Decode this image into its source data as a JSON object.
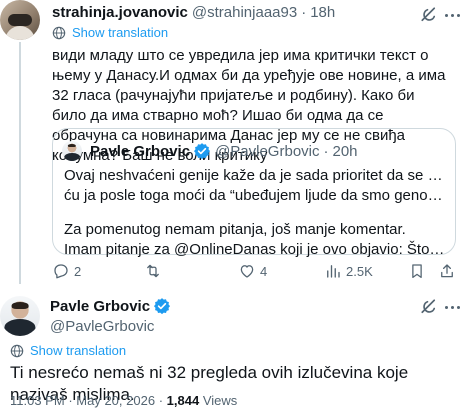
{
  "reply_tweet": {
    "author_name": "strahinja.jovanovic",
    "author_handle": "@strahinjaaa93",
    "separator": "·",
    "time": "18h",
    "translate_label": "Show translation",
    "text": "види младу што се увредила јер има критички текст о њему у Данасу.И одмах би да уређује ове новине, а има 32 гласа (рачунајући пријатеље и родбину). Како би било да има стварно моћ? Ишао би одма да се обрачуна са новинарима Данас јер му се не свиђа колумна? Баш не воли критику",
    "quote": {
      "author_name": "Pavle Grbovic",
      "author_handle": "@PavleGrbovic",
      "separator": "·",
      "time": "20h",
      "lines": [
        "Ovaj neshvaćeni genije kaže da je sada prioritet da se oslobodi Srbija pa",
        "ću ja posle toga moći da “ubeđujem ljude da smo genocidan narod”.",
        "Za pomenutog nemam pitanja, još manje komentar.",
        "Imam pitanje za @OnlineDanas koji je ovo objavio: Što ne date Bokan..."
      ]
    },
    "actions": {
      "replies": "2",
      "retweets": "",
      "likes": "4",
      "views": "2.5K"
    }
  },
  "main_tweet": {
    "author_name": "Pavle Grbovic",
    "author_handle": "@PavleGrbovic",
    "translate_label": "Show translation",
    "text": "Ti nesrećo nemaš ni 32 pregleda ovih izlučevina koje nazivaš mislima.",
    "time": "11:03 PM",
    "separator": "·",
    "date": "May 20, 2026",
    "views_count": "1,844",
    "views_label": "Views"
  },
  "colors": {
    "accent": "#1d9bf0",
    "muted": "#536471",
    "text": "#0f1419",
    "border": "#cfd9de"
  },
  "icons": [
    "grok-icon",
    "more-icon",
    "globe-icon",
    "verified-icon",
    "reply-icon",
    "retweet-icon",
    "like-icon",
    "views-icon",
    "bookmark-icon",
    "share-icon"
  ]
}
